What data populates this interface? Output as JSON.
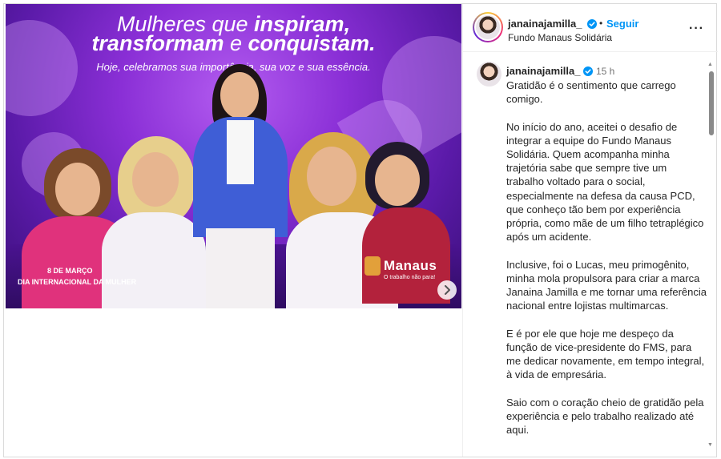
{
  "post": {
    "image": {
      "headline_line1_prefix": "Mulheres que ",
      "headline_line1_strong": "inspiram,",
      "headline_line2_strong": "transformam",
      "headline_line2_mid": " e ",
      "headline_line2_end": "conquistam.",
      "subline": "Hoje, celebramos sua importância, sua voz e sua essência.",
      "date_label": "8 DE MARÇO",
      "event_label": "DIA INTERNACIONAL DA MULHER",
      "brand_name": "Manaus",
      "brand_slogan": "O trabalho não para!"
    },
    "next_icon": "chevron-right-icon"
  },
  "header": {
    "username": "janainajamilla_",
    "separator": "•",
    "follow_label": "Seguir",
    "location": "Fundo Manaus Solidária",
    "more_icon": "more-horizontal-icon",
    "more_label": "···"
  },
  "comment": {
    "username": "janainajamilla_",
    "time": "15 h",
    "paragraphs": [
      "Gratidão é o sentimento que carrego comigo.",
      "No início do ano, aceitei o desafio de integrar a equipe do Fundo Manaus Solidária. Quem acompanha minha trajetória sabe que sempre tive um trabalho voltado para o social, especialmente na defesa da causa PCD, que conheço tão bem por experiência própria, como mãe de um filho tetraplégico após um acidente.",
      "Inclusive, foi o Lucas, meu primogênito, minha mola propulsora para criar a marca Janaina Jamilla e me tornar uma referência nacional entre lojistas multimarcas.",
      "E é por ele que hoje me despeço da função de vice-presidente do FMS, para me dedicar novamente, em tempo integral, à vida de empresária.",
      "Saio com o coração cheio de gratidão pela experiência e pelo trabalho realizado até aqui."
    ]
  },
  "colors": {
    "accent": "#0095f6",
    "verified": "#0095f6",
    "text": "#262626",
    "muted": "#737373"
  }
}
